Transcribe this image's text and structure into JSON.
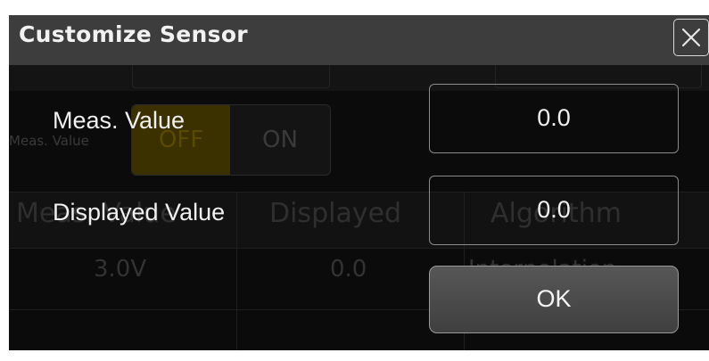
{
  "dialog": {
    "title": "Customize Sensor",
    "close_icon": "close-icon",
    "fields": [
      {
        "label": "Meas. Value",
        "value": "0.0"
      },
      {
        "label": "Displayed Value",
        "value": "0.0"
      }
    ],
    "ok_label": "OK"
  },
  "background": {
    "meas_value_label": "Meas. Value",
    "toggle_off": "OFF",
    "toggle_on": "ON",
    "table_headers": [
      "Meas. Value",
      "Displayed",
      "Algorithm"
    ],
    "table_row": [
      "3.0V",
      "0.0",
      "Interpolation"
    ]
  },
  "colors": {
    "title_bar": "#3d3d3d",
    "dialog_bg": "#0b0b0b",
    "input_border": "#8a8a8a",
    "ok_button": "#4a4a4a"
  }
}
